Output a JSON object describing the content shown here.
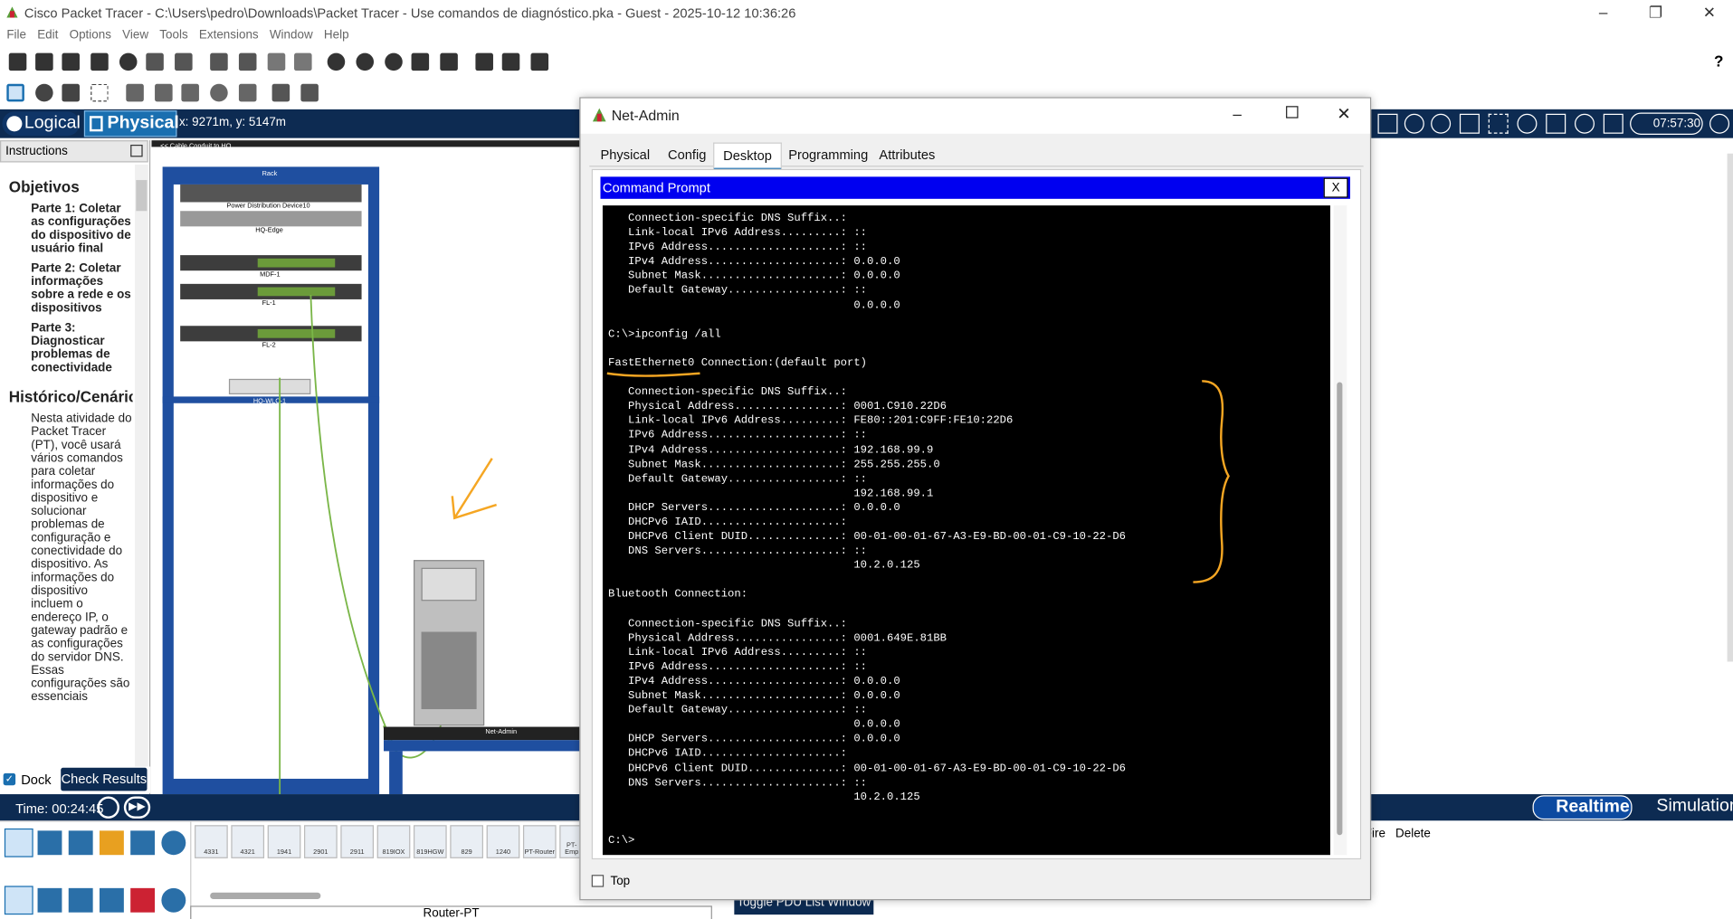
{
  "app": {
    "window_title": "Cisco Packet Tracer - C:\\Users\\pedro\\Downloads\\Packet Tracer - Use comandos de diagnóstico.pka - Guest - 2025-10-12 10:36:26",
    "menu": [
      "File",
      "Edit",
      "Options",
      "View",
      "Tools",
      "Extensions",
      "Window",
      "Help"
    ]
  },
  "modebar": {
    "logical": "Logical",
    "physical": "Physical",
    "coords": "x: 9271m, y: 5147m",
    "clock": "07:57:30"
  },
  "instructions": {
    "header": "Instructions",
    "heading1": "Objetivos",
    "parte1": "Parte 1: Coletar as configurações do dispositivo de usuário final",
    "parte2": "Parte 2: Coletar informações sobre a rede e os dispositivos",
    "parte3": "Parte 3: Diagnosticar problemas de conectividade",
    "heading2": "Histórico/Cenário",
    "body": "Nesta atividade do Packet Tracer (PT), você usará vários comandos para coletar informações do dispositivo e solucionar problemas de configuração e conectividade do dispositivo. As informações do dispositivo incluem o endereço IP, o gateway padrão e as configurações do servidor DNS. Essas configurações são essenciais",
    "dock": "Dock",
    "check_results": "Check Results"
  },
  "workspace": {
    "conduit": "<< Cable Conduit to HQ",
    "rack": "Rack",
    "pdu": "Power Distribution Device10",
    "hq_edge": "HQ-Edge",
    "mdf": "MDF-1",
    "fl1": "FL-1",
    "fl2": "FL-2",
    "hq_wlc": "HQ-WLC-1",
    "netadmin_label": "Net-Admin"
  },
  "timebar": {
    "time": "Time: 00:24:45",
    "realtime": "Realtime",
    "simulation": "Simulation"
  },
  "devices": {
    "models": [
      "4331",
      "4321",
      "1941",
      "2901",
      "2911",
      "819IOX",
      "819HGW",
      "829",
      "1240",
      "PT-Router",
      "PT-Emp"
    ],
    "selected_name": "Router-PT",
    "toggle_pdu": "Toggle PDU List Window"
  },
  "pdu_panel": {
    "col_fire": "Fire",
    "col_delete": "Delete"
  },
  "dialog": {
    "title": "Net-Admin",
    "tabs": [
      "Physical",
      "Config",
      "Desktop",
      "Programming",
      "Attributes"
    ],
    "active_tab": "Desktop",
    "cmd_title": "Command Prompt",
    "close_x": "X",
    "top_label": "Top",
    "terminal": [
      "   Connection-specific DNS Suffix..:",
      "   Link-local IPv6 Address.........: ::",
      "   IPv6 Address....................: ::",
      "   IPv4 Address....................: 0.0.0.0",
      "   Subnet Mask.....................: 0.0.0.0",
      "   Default Gateway.................: ::",
      "                                     0.0.0.0",
      "",
      "C:\\>ipconfig /all",
      "",
      "FastEthernet0 Connection:(default port)",
      "",
      "   Connection-specific DNS Suffix..:",
      "   Physical Address................: 0001.C910.22D6",
      "   Link-local IPv6 Address.........: FE80::201:C9FF:FE10:22D6",
      "   IPv6 Address....................: ::",
      "   IPv4 Address....................: 192.168.99.9",
      "   Subnet Mask.....................: 255.255.255.0",
      "   Default Gateway.................: ::",
      "                                     192.168.99.1",
      "   DHCP Servers....................: 0.0.0.0",
      "   DHCPv6 IAID.....................: ",
      "   DHCPv6 Client DUID..............: 00-01-00-01-67-A3-E9-BD-00-01-C9-10-22-D6",
      "   DNS Servers.....................: ::",
      "                                     10.2.0.125",
      "",
      "Bluetooth Connection:",
      "",
      "   Connection-specific DNS Suffix..:",
      "   Physical Address................: 0001.649E.81BB",
      "   Link-local IPv6 Address.........: ::",
      "   IPv6 Address....................: ::",
      "   IPv4 Address....................: 0.0.0.0",
      "   Subnet Mask.....................: 0.0.0.0",
      "   Default Gateway.................: ::",
      "                                     0.0.0.0",
      "   DHCP Servers....................: 0.0.0.0",
      "   DHCPv6 IAID.....................: ",
      "   DHCPv6 Client DUID..............: 00-01-00-01-67-A3-E9-BD-00-01-C9-10-22-D6",
      "   DNS Servers.....................: ::",
      "                                     10.2.0.125",
      "",
      "",
      "C:\\>"
    ]
  },
  "colors": {
    "navy": "#0d2b52",
    "cmd_blue": "#0000f0",
    "annotation": "#f5a623"
  }
}
